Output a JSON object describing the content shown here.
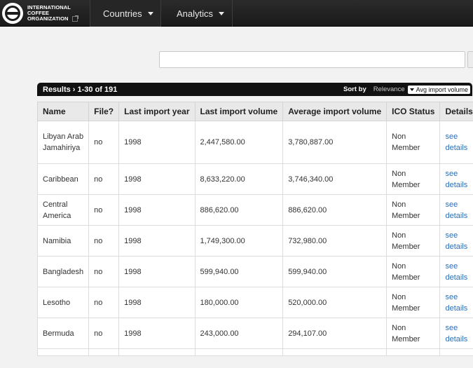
{
  "brand": {
    "line1": "INTERNATIONAL",
    "line2": "COFFEE",
    "line3": "ORGANIZATION"
  },
  "nav": {
    "countries": "Countries",
    "analytics": "Analytics"
  },
  "search": {
    "value": "",
    "placeholder": ""
  },
  "results": {
    "count_label": "Results › 1-30 of 191",
    "sort_by": "Sort by",
    "sort_relevance": "Relevance",
    "sort_active": "Avg import volume"
  },
  "table": {
    "headers": [
      "Name",
      "File?",
      "Last import year",
      "Last import volume",
      "Average import volume",
      "ICO Status",
      "Details"
    ],
    "rows": [
      {
        "name": "Libyan Arab Jamahiriya",
        "file": "no",
        "year": "1998",
        "last_volume": "2,447,580.00",
        "avg_volume": "3,780,887.00",
        "status": "Non Member",
        "details": "see details"
      },
      {
        "name": "Caribbean",
        "file": "no",
        "year": "1998",
        "last_volume": "8,633,220.00",
        "avg_volume": "3,746,340.00",
        "status": "Non Member",
        "details": "see details"
      },
      {
        "name": "Central America",
        "file": "no",
        "year": "1998",
        "last_volume": "886,620.00",
        "avg_volume": "886,620.00",
        "status": "Non Member",
        "details": "see details"
      },
      {
        "name": "Namibia",
        "file": "no",
        "year": "1998",
        "last_volume": "1,749,300.00",
        "avg_volume": "732,980.00",
        "status": "Non Member",
        "details": "see details"
      },
      {
        "name": "Bangladesh",
        "file": "no",
        "year": "1998",
        "last_volume": "599,940.00",
        "avg_volume": "599,940.00",
        "status": "Non Member",
        "details": "see details"
      },
      {
        "name": "Lesotho",
        "file": "no",
        "year": "1998",
        "last_volume": "180,000.00",
        "avg_volume": "520,000.00",
        "status": "Non Member",
        "details": "see details"
      },
      {
        "name": "Bermuda",
        "file": "no",
        "year": "1998",
        "last_volume": "243,000.00",
        "avg_volume": "294,107.00",
        "status": "Non Member",
        "details": "see details"
      }
    ]
  }
}
